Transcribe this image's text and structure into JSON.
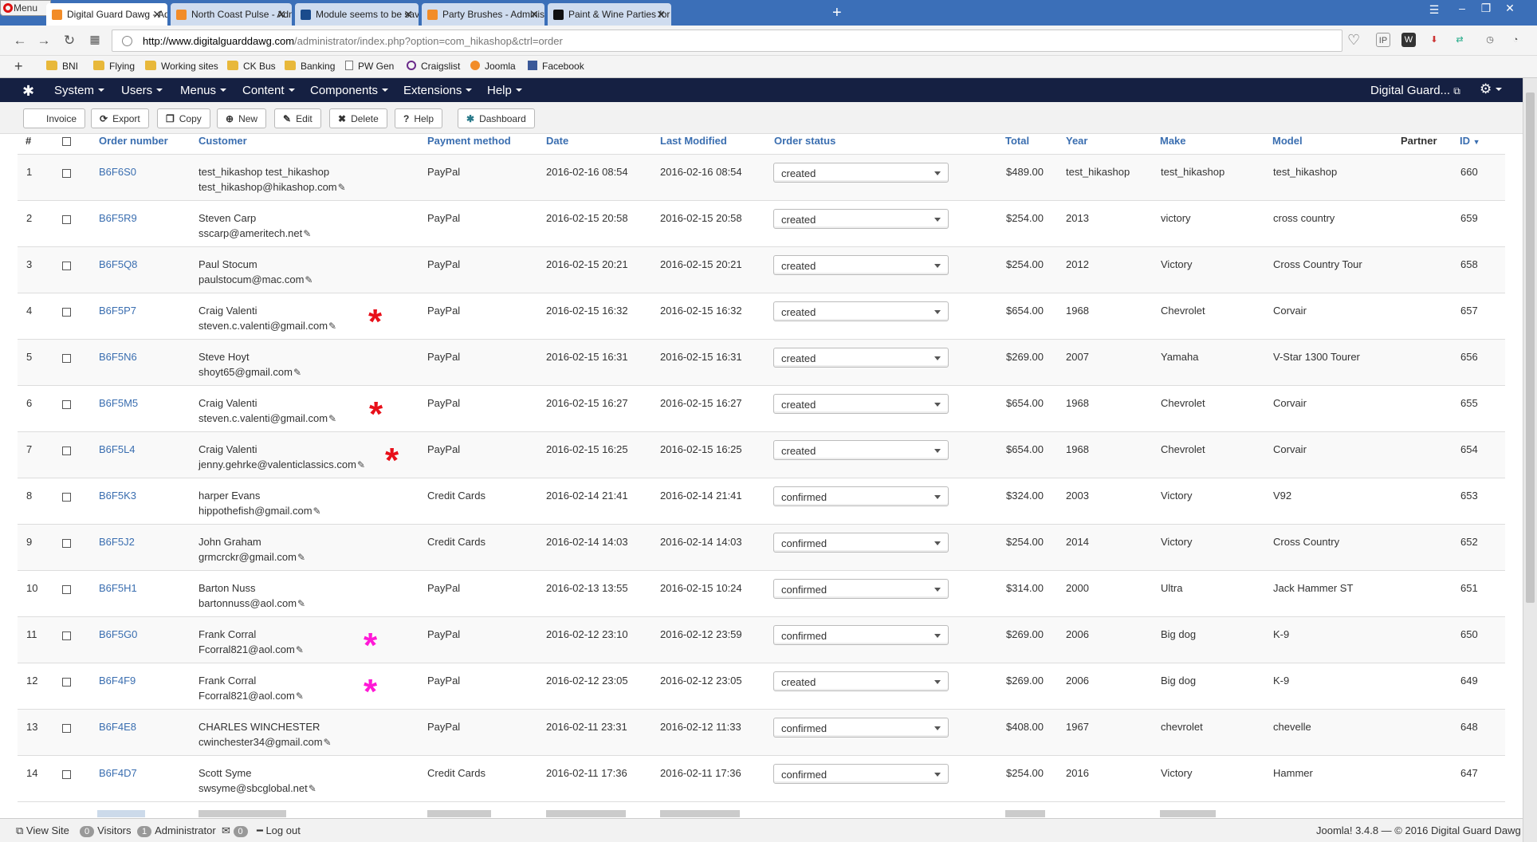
{
  "browser": {
    "menu_label": "Menu",
    "tabs": [
      {
        "title": "Digital Guard Dawg - Administration",
        "favicon": "joomla-icon",
        "color": "#f28c28"
      },
      {
        "title": "North Coast Pulse - Administration",
        "favicon": "joomla-icon",
        "color": "#f28c28"
      },
      {
        "title": "Module seems to be saving a...",
        "favicon": "joomla-jd-icon",
        "color": "#1a4b8c"
      },
      {
        "title": "Party Brushes - Administration",
        "favicon": "joomla-icon",
        "color": "#f28c28"
      },
      {
        "title": "Paint & Wine Parties for any...",
        "favicon": "site-icon",
        "color": "#111111"
      }
    ],
    "url_host": "http://www.digitalguarddawg.com",
    "url_path": "/administrator/index.php?option=com_hikashop&ctrl=order",
    "bookmarks": [
      {
        "label": "BNI",
        "type": "folder"
      },
      {
        "label": "Flying",
        "type": "folder"
      },
      {
        "label": "Working sites",
        "type": "folder"
      },
      {
        "label": "CK Bus",
        "type": "folder"
      },
      {
        "label": "Banking",
        "type": "folder"
      },
      {
        "label": "PW Gen",
        "type": "page"
      },
      {
        "label": "Craigslist",
        "type": "peace"
      },
      {
        "label": "Joomla",
        "type": "joomla"
      },
      {
        "label": "Facebook",
        "type": "facebook"
      }
    ]
  },
  "admin": {
    "menus": [
      "System",
      "Users",
      "Menus",
      "Content",
      "Components",
      "Extensions",
      "Help"
    ],
    "site_name": "Digital Guard...",
    "toolbar": [
      {
        "label": "Invoice",
        "icon": ""
      },
      {
        "label": "Export",
        "icon": "export-icon"
      },
      {
        "label": "Copy",
        "icon": "copy-icon"
      },
      {
        "label": "New",
        "icon": "plus-icon"
      },
      {
        "label": "Edit",
        "icon": "edit-icon"
      },
      {
        "label": "Delete",
        "icon": "delete-icon"
      },
      {
        "label": "Help",
        "icon": "help-icon"
      },
      {
        "label": "Dashboard",
        "icon": "dashboard-icon"
      }
    ]
  },
  "table": {
    "headers": {
      "num": "#",
      "order_number": "Order number",
      "customer": "Customer",
      "payment": "Payment method",
      "date": "Date",
      "last_modified": "Last Modified",
      "status": "Order status",
      "total": "Total",
      "year": "Year",
      "make": "Make",
      "model": "Model",
      "partner": "Partner",
      "id": "ID"
    },
    "rows": [
      {
        "num": "1",
        "order": "B6F6S0",
        "name": "test_hikashop test_hikashop",
        "email": "test_hikashop@hikashop.com",
        "payment": "PayPal",
        "date": "2016-02-16 08:54",
        "modified": "2016-02-16 08:54",
        "status": "created",
        "total": "$489.00",
        "year": "test_hikashop",
        "make": "test_hikashop",
        "model": "test_hikashop",
        "id": "660",
        "mark": ""
      },
      {
        "num": "2",
        "order": "B6F5R9",
        "name": "Steven Carp",
        "email": "sscarp@ameritech.net",
        "payment": "PayPal",
        "date": "2016-02-15 20:58",
        "modified": "2016-02-15 20:58",
        "status": "created",
        "total": "$254.00",
        "year": "2013",
        "make": "victory",
        "model": "cross country",
        "id": "659",
        "mark": ""
      },
      {
        "num": "3",
        "order": "B6F5Q8",
        "name": "Paul Stocum",
        "email": "paulstocum@mac.com",
        "payment": "PayPal",
        "date": "2016-02-15 20:21",
        "modified": "2016-02-15 20:21",
        "status": "created",
        "total": "$254.00",
        "year": "2012",
        "make": "Victory",
        "model": "Cross Country Tour",
        "id": "658",
        "mark": ""
      },
      {
        "num": "4",
        "order": "B6F5P7",
        "name": "Craig Valenti",
        "email": "steven.c.valenti@gmail.com",
        "payment": "PayPal",
        "date": "2016-02-15 16:32",
        "modified": "2016-02-15 16:32",
        "status": "created",
        "total": "$654.00",
        "year": "1968",
        "make": "Chevrolet",
        "model": "Corvair",
        "id": "657",
        "mark": "#e8101a"
      },
      {
        "num": "5",
        "order": "B6F5N6",
        "name": "Steve Hoyt",
        "email": "shoyt65@gmail.com",
        "payment": "PayPal",
        "date": "2016-02-15 16:31",
        "modified": "2016-02-15 16:31",
        "status": "created",
        "total": "$269.00",
        "year": "2007",
        "make": "Yamaha",
        "model": "V-Star 1300 Tourer",
        "id": "656",
        "mark": ""
      },
      {
        "num": "6",
        "order": "B6F5M5",
        "name": "Craig Valenti",
        "email": "steven.c.valenti@gmail.com",
        "payment": "PayPal",
        "date": "2016-02-15 16:27",
        "modified": "2016-02-15 16:27",
        "status": "created",
        "total": "$654.00",
        "year": "1968",
        "make": "Chevrolet",
        "model": "Corvair",
        "id": "655",
        "mark": "#e8101a"
      },
      {
        "num": "7",
        "order": "B6F5L4",
        "name": "Craig Valenti",
        "email": "jenny.gehrke@valenticlassics.com",
        "payment": "PayPal",
        "date": "2016-02-15 16:25",
        "modified": "2016-02-15 16:25",
        "status": "created",
        "total": "$654.00",
        "year": "1968",
        "make": "Chevrolet",
        "model": "Corvair",
        "id": "654",
        "mark": "#e8101a"
      },
      {
        "num": "8",
        "order": "B6F5K3",
        "name": "harper Evans",
        "email": "hippothefish@gmail.com",
        "payment": "Credit Cards",
        "date": "2016-02-14 21:41",
        "modified": "2016-02-14 21:41",
        "status": "confirmed",
        "total": "$324.00",
        "year": "2003",
        "make": "Victory",
        "model": "V92",
        "id": "653",
        "mark": ""
      },
      {
        "num": "9",
        "order": "B6F5J2",
        "name": "John Graham",
        "email": "grmcrckr@gmail.com",
        "payment": "Credit Cards",
        "date": "2016-02-14 14:03",
        "modified": "2016-02-14 14:03",
        "status": "confirmed",
        "total": "$254.00",
        "year": "2014",
        "make": "Victory",
        "model": "Cross Country",
        "id": "652",
        "mark": ""
      },
      {
        "num": "10",
        "order": "B6F5H1",
        "name": "Barton Nuss",
        "email": "bartonnuss@aol.com",
        "payment": "PayPal",
        "date": "2016-02-13 13:55",
        "modified": "2016-02-15 10:24",
        "status": "confirmed",
        "total": "$314.00",
        "year": "2000",
        "make": "Ultra",
        "model": "Jack Hammer ST",
        "id": "651",
        "mark": ""
      },
      {
        "num": "11",
        "order": "B6F5G0",
        "name": "Frank Corral",
        "email": "Fcorral821@aol.com",
        "payment": "PayPal",
        "date": "2016-02-12 23:10",
        "modified": "2016-02-12 23:59",
        "status": "confirmed",
        "total": "$269.00",
        "year": "2006",
        "make": "Big dog",
        "model": "K-9",
        "id": "650",
        "mark": "#ff19d6"
      },
      {
        "num": "12",
        "order": "B6F4F9",
        "name": "Frank Corral",
        "email": "Fcorral821@aol.com",
        "payment": "PayPal",
        "date": "2016-02-12 23:05",
        "modified": "2016-02-12 23:05",
        "status": "created",
        "total": "$269.00",
        "year": "2006",
        "make": "Big dog",
        "model": "K-9",
        "id": "649",
        "mark": "#ff19d6"
      },
      {
        "num": "13",
        "order": "B6F4E8",
        "name": "CHARLES WINCHESTER",
        "email": "cwinchester34@gmail.com",
        "payment": "PayPal",
        "date": "2016-02-11 23:31",
        "modified": "2016-02-12 11:33",
        "status": "confirmed",
        "total": "$408.00",
        "year": "1967",
        "make": "chevrolet",
        "model": "chevelle",
        "id": "648",
        "mark": ""
      },
      {
        "num": "14",
        "order": "B6F4D7",
        "name": "Scott Syme",
        "email": "swsyme@sbcglobal.net",
        "payment": "Credit Cards",
        "date": "2016-02-11 17:36",
        "modified": "2016-02-11 17:36",
        "status": "confirmed",
        "total": "$254.00",
        "year": "2016",
        "make": "Victory",
        "model": "Hammer",
        "id": "647",
        "mark": ""
      }
    ]
  },
  "footer": {
    "view_site": "View Site",
    "visitors_count": "0",
    "visitors_label": "Visitors",
    "admins_count": "1",
    "admins_label": "Administrator",
    "messages_count": "0",
    "logout": "Log out",
    "copyright": "Joomla! 3.4.8 — © 2016 Digital Guard Dawg"
  }
}
